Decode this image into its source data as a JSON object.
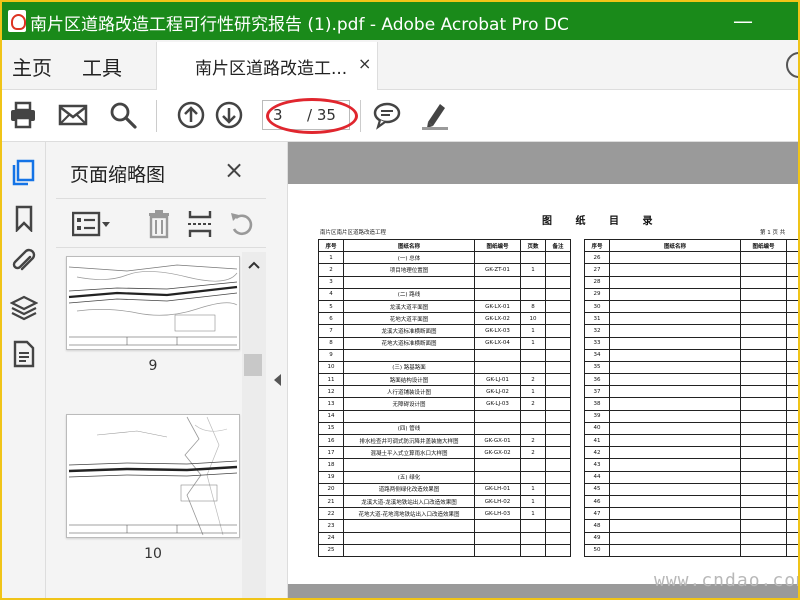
{
  "window": {
    "title": "南片区道路改造工程可行性研究报告 (1).pdf - Adobe Acrobat Pro DC",
    "minimize": "—",
    "colors": {
      "titlebar": "#1a8a1a",
      "frame": "#f0c418",
      "highlight": "#e0262e"
    }
  },
  "menu": {
    "home": "主页",
    "tools": "工具"
  },
  "tab": {
    "label": "南片区道路改造工...",
    "close": "×"
  },
  "toolbar": {
    "page_current": "3",
    "page_total": "/ 35",
    "icons": [
      "print-icon",
      "email-icon",
      "search-icon",
      "page-up-icon",
      "page-down-icon",
      "comment-icon",
      "highlight-pen-icon"
    ]
  },
  "rail": {
    "icons": [
      "pages-icon",
      "bookmark-icon",
      "attachment-icon",
      "layers-icon",
      "document-icon"
    ]
  },
  "thumbnails": {
    "title": "页面缩略图",
    "close": "×",
    "pages": [
      {
        "number": "9"
      },
      {
        "number": "10"
      }
    ]
  },
  "document": {
    "title": "图 纸 目 录",
    "project": "南片区南片区道路改造工程",
    "page_info": "第 1 页   共",
    "headers": {
      "no": "序号",
      "name": "图纸名称",
      "code": "图纸编号",
      "pages": "页数",
      "remark": "备注"
    },
    "left_rows": [
      {
        "no": "1",
        "name": "(一) 总体",
        "code": "",
        "pages": ""
      },
      {
        "no": "2",
        "name": "项目地理位置图",
        "code": "GK-ZT-01",
        "pages": "1"
      },
      {
        "no": "3",
        "name": "",
        "code": "",
        "pages": ""
      },
      {
        "no": "4",
        "name": "(二) 路线",
        "code": "",
        "pages": ""
      },
      {
        "no": "5",
        "name": "龙溪大道平面图",
        "code": "GK-LX-01",
        "pages": "8"
      },
      {
        "no": "6",
        "name": "花地大道平面图",
        "code": "GK-LX-02",
        "pages": "10"
      },
      {
        "no": "7",
        "name": "龙溪大道标准横断面图",
        "code": "GK-LX-03",
        "pages": "1"
      },
      {
        "no": "8",
        "name": "花地大道标准横断面图",
        "code": "GK-LX-04",
        "pages": "1"
      },
      {
        "no": "9",
        "name": "",
        "code": "",
        "pages": ""
      },
      {
        "no": "10",
        "name": "(三) 路基路面",
        "code": "",
        "pages": ""
      },
      {
        "no": "11",
        "name": "路面结构设计图",
        "code": "GK-LJ-01",
        "pages": "2"
      },
      {
        "no": "12",
        "name": "人行道铺装设计图",
        "code": "GK-LJ-02",
        "pages": "1"
      },
      {
        "no": "13",
        "name": "无障碍设计图",
        "code": "GK-LJ-03",
        "pages": "2"
      },
      {
        "no": "14",
        "name": "",
        "code": "",
        "pages": ""
      },
      {
        "no": "15",
        "name": "(四) 管线",
        "code": "",
        "pages": ""
      },
      {
        "no": "16",
        "name": "排水检查井可调式防沉降井盖装施大样图",
        "code": "GK-GX-01",
        "pages": "2"
      },
      {
        "no": "17",
        "name": "混凝土平入式立算雨水口大样图",
        "code": "GK-GX-02",
        "pages": "2"
      },
      {
        "no": "18",
        "name": "",
        "code": "",
        "pages": ""
      },
      {
        "no": "19",
        "name": "(五) 绿化",
        "code": "",
        "pages": ""
      },
      {
        "no": "20",
        "name": "道路两侧绿化改造效果图",
        "code": "GK-LH-01",
        "pages": "1"
      },
      {
        "no": "21",
        "name": "龙溪大道-龙溪地铁站出入口改造效果图",
        "code": "GK-LH-02",
        "pages": "1"
      },
      {
        "no": "22",
        "name": "花地大道-花地湾地铁站出入口改造效果图",
        "code": "GK-LH-03",
        "pages": "1"
      },
      {
        "no": "23",
        "name": "",
        "code": "",
        "pages": ""
      },
      {
        "no": "24",
        "name": "",
        "code": "",
        "pages": ""
      },
      {
        "no": "25",
        "name": "",
        "code": "",
        "pages": ""
      }
    ],
    "right_rows": [
      "26",
      "27",
      "28",
      "29",
      "30",
      "31",
      "32",
      "33",
      "34",
      "35",
      "36",
      "37",
      "38",
      "39",
      "40",
      "41",
      "42",
      "43",
      "44",
      "45",
      "46",
      "47",
      "48",
      "49",
      "50"
    ]
  },
  "watermark": "www.cndao.com"
}
